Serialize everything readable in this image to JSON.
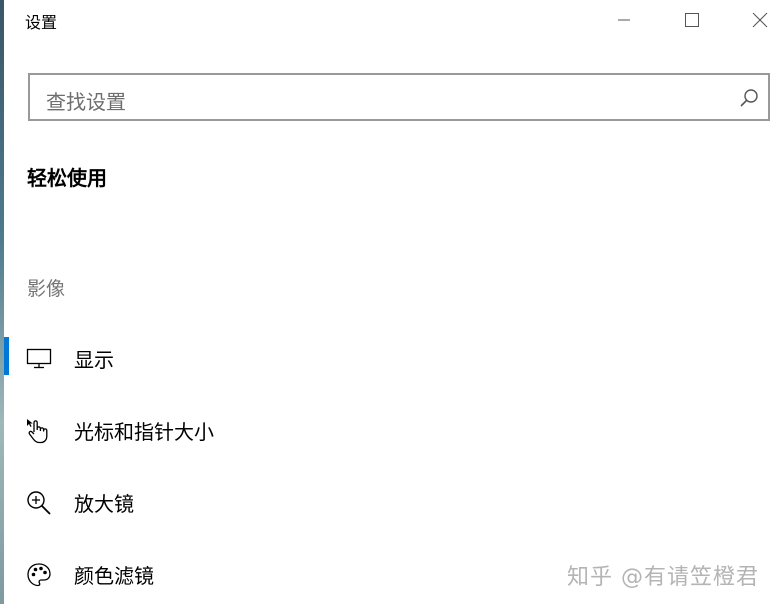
{
  "window": {
    "title": "设置",
    "minimize_icon": "minimize-icon",
    "maximize_icon": "maximize-icon",
    "close_icon": "close-icon"
  },
  "search": {
    "placeholder": "查找设置",
    "icon": "search-icon"
  },
  "section": {
    "title": "轻松使用"
  },
  "group": {
    "label": "影像"
  },
  "nav": {
    "items": [
      {
        "label": "显示",
        "icon": "monitor-icon",
        "selected": true
      },
      {
        "label": "光标和指针大小",
        "icon": "pointer-hand-icon",
        "selected": false
      },
      {
        "label": "放大镜",
        "icon": "magnifier-icon",
        "selected": false
      },
      {
        "label": "颜色滤镜",
        "icon": "palette-icon",
        "selected": false
      }
    ]
  },
  "watermark": {
    "text": "知乎 @有请笠橙君"
  },
  "colors": {
    "accent": "#0078d7",
    "search_border": "#999999",
    "muted_text": "#767676"
  }
}
